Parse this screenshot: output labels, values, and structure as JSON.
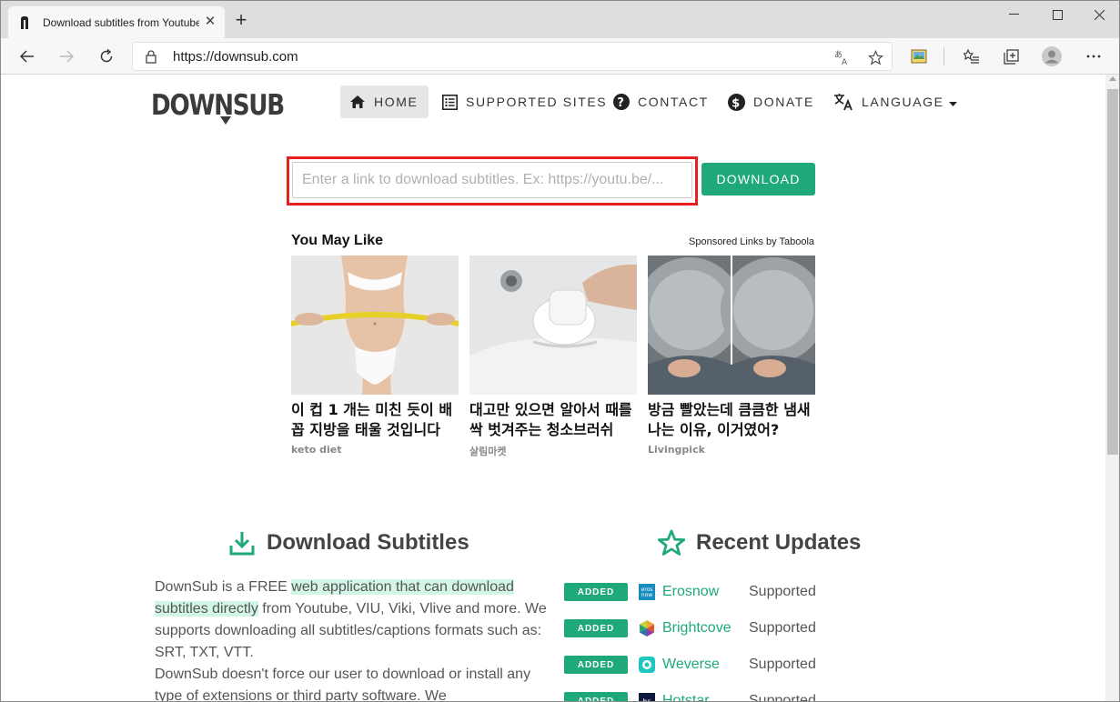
{
  "browser": {
    "tab_title": "Download subtitles from Youtube",
    "url": "https://downsub.com"
  },
  "site": {
    "logo_text": "DOWNSUB",
    "nav": [
      {
        "label": "HOME",
        "icon": "home-icon"
      },
      {
        "label": "SUPPORTED SITES",
        "icon": "list-icon"
      },
      {
        "label": "CONTACT",
        "icon": "question-circle-icon"
      },
      {
        "label": "DONATE",
        "icon": "dollar-circle-icon"
      },
      {
        "label": "LANGUAGE",
        "icon": "translate-icon"
      }
    ],
    "search": {
      "placeholder": "Enter a link to download subtitles. Ex: https://youtu.be/...",
      "button_label": "DOWNLOAD"
    },
    "you_may_like": {
      "title": "You May Like",
      "sponsor": "Sponsored Links by Taboola",
      "cards": [
        {
          "title": "이 컵 1 개는 미친 듯이 배꼽 지방을 태울 것입니다",
          "source": "keto diet"
        },
        {
          "title": "대고만 있으면 알아서 때를 싹 벗겨주는 청소브러쉬",
          "source": "살림마켓"
        },
        {
          "title": "방금 빨았는데 큼큼한 냄새 나는 이유, 이거였어?",
          "source": "Livingpick"
        }
      ]
    },
    "download_subtitles": {
      "title": "Download Subtitles",
      "text_before": "DownSub is a FREE ",
      "text_highlight": "web application that can download subtitles directly",
      "text_after": " from Youtube, VIU, Viki, Vlive and more. We supports downloading all subtitles/captions formats such as: SRT, TXT, VTT.",
      "text_para2": "DownSub doesn't force our user to download or install any type of extensions or third party software. We"
    },
    "recent_updates": {
      "title": "Recent Updates",
      "items": [
        {
          "badge": "ADDED",
          "name": "Erosnow",
          "status": "Supported",
          "color": "#1a8bbf"
        },
        {
          "badge": "ADDED",
          "name": "Brightcove",
          "status": "Supported",
          "color": "#e0542c"
        },
        {
          "badge": "ADDED",
          "name": "Weverse",
          "status": "Supported",
          "color": "#1fc7c2"
        },
        {
          "badge": "ADDED",
          "name": "Hotstar",
          "status": "Supported",
          "color": "#0e1a3d"
        }
      ]
    },
    "accent_color": "#1ea87b"
  }
}
